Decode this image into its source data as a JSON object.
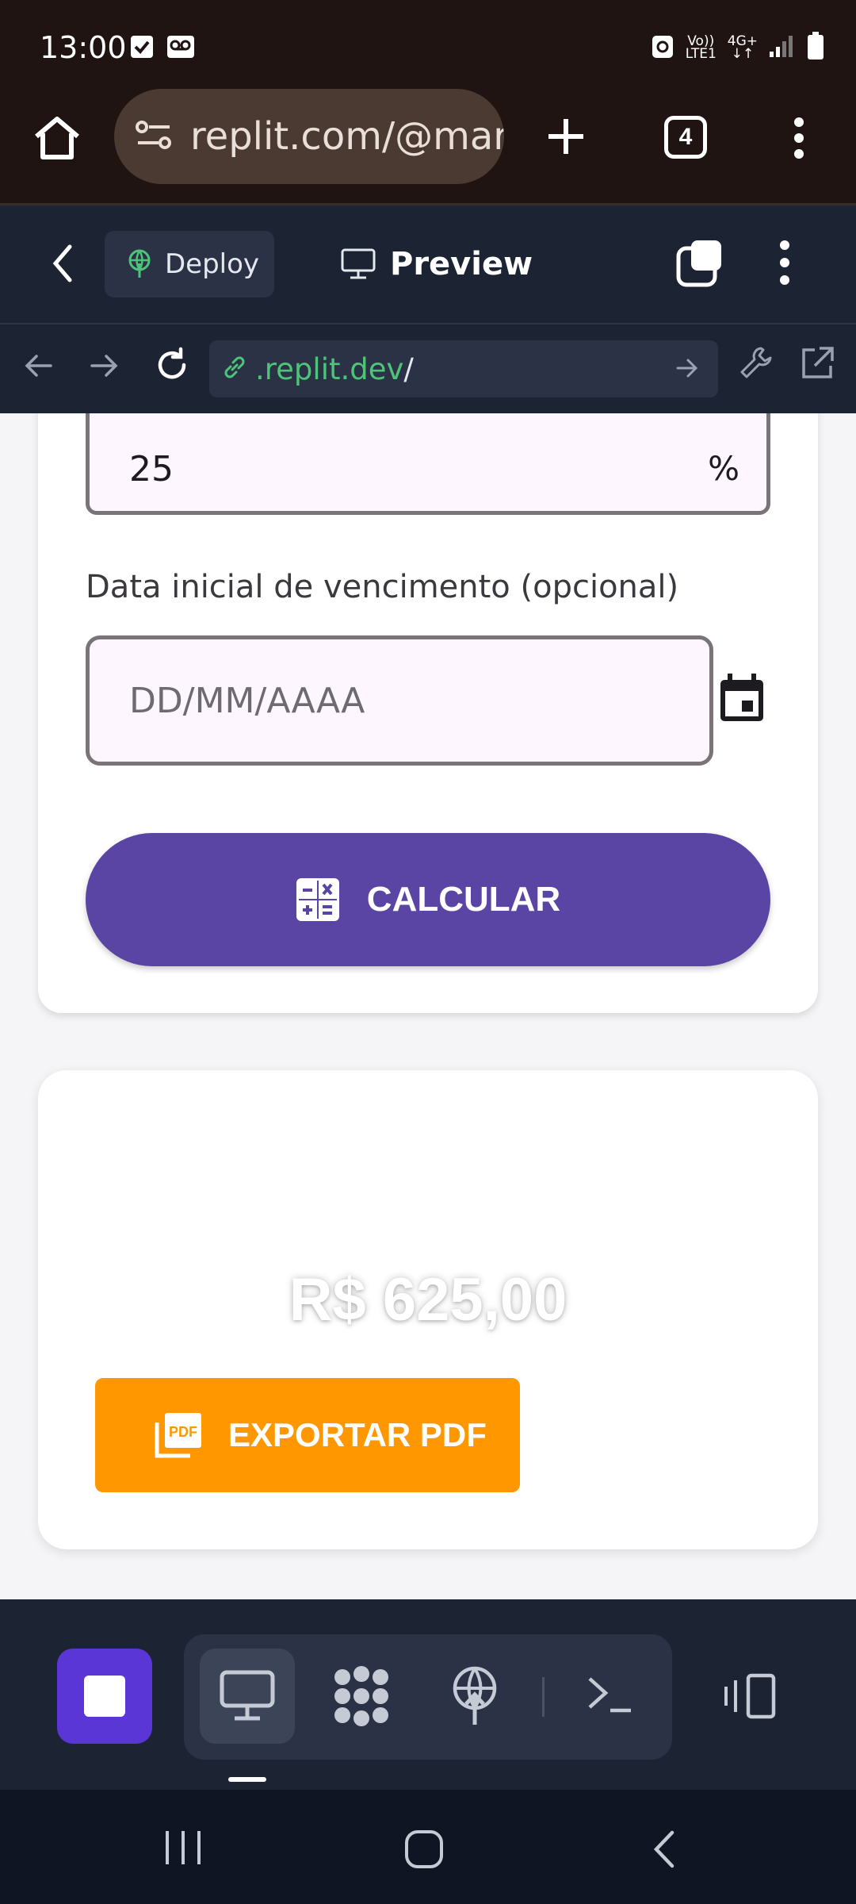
{
  "status_bar": {
    "time": "13:00",
    "network_line1": "Vo))",
    "network_line2": "LTE1",
    "network_type": "4G+",
    "icons": [
      "check-notification-icon",
      "voicemail-icon",
      "recycle-icon",
      "signal-icon",
      "battery-icon"
    ]
  },
  "browser": {
    "url": "replit.com/@mari",
    "tab_count": "4"
  },
  "replit_header": {
    "deploy_label": "Deploy",
    "preview_label": "Preview"
  },
  "webview": {
    "url_highlight": ".replit.dev",
    "url_rest": "/"
  },
  "form": {
    "percent_value": "25",
    "percent_suffix": "%",
    "date_label": "Data inicial de vencimento (opcional)",
    "date_placeholder": "DD/MM/AAAA",
    "calculate_label": "CALCULAR"
  },
  "result": {
    "total": "R$ 625,00",
    "export_label": "EXPORTAR PDF"
  },
  "colors": {
    "primary": "#5b45a4",
    "export": "#ff9800",
    "stop": "#5b36d6",
    "url_green": "#4ec47a"
  }
}
